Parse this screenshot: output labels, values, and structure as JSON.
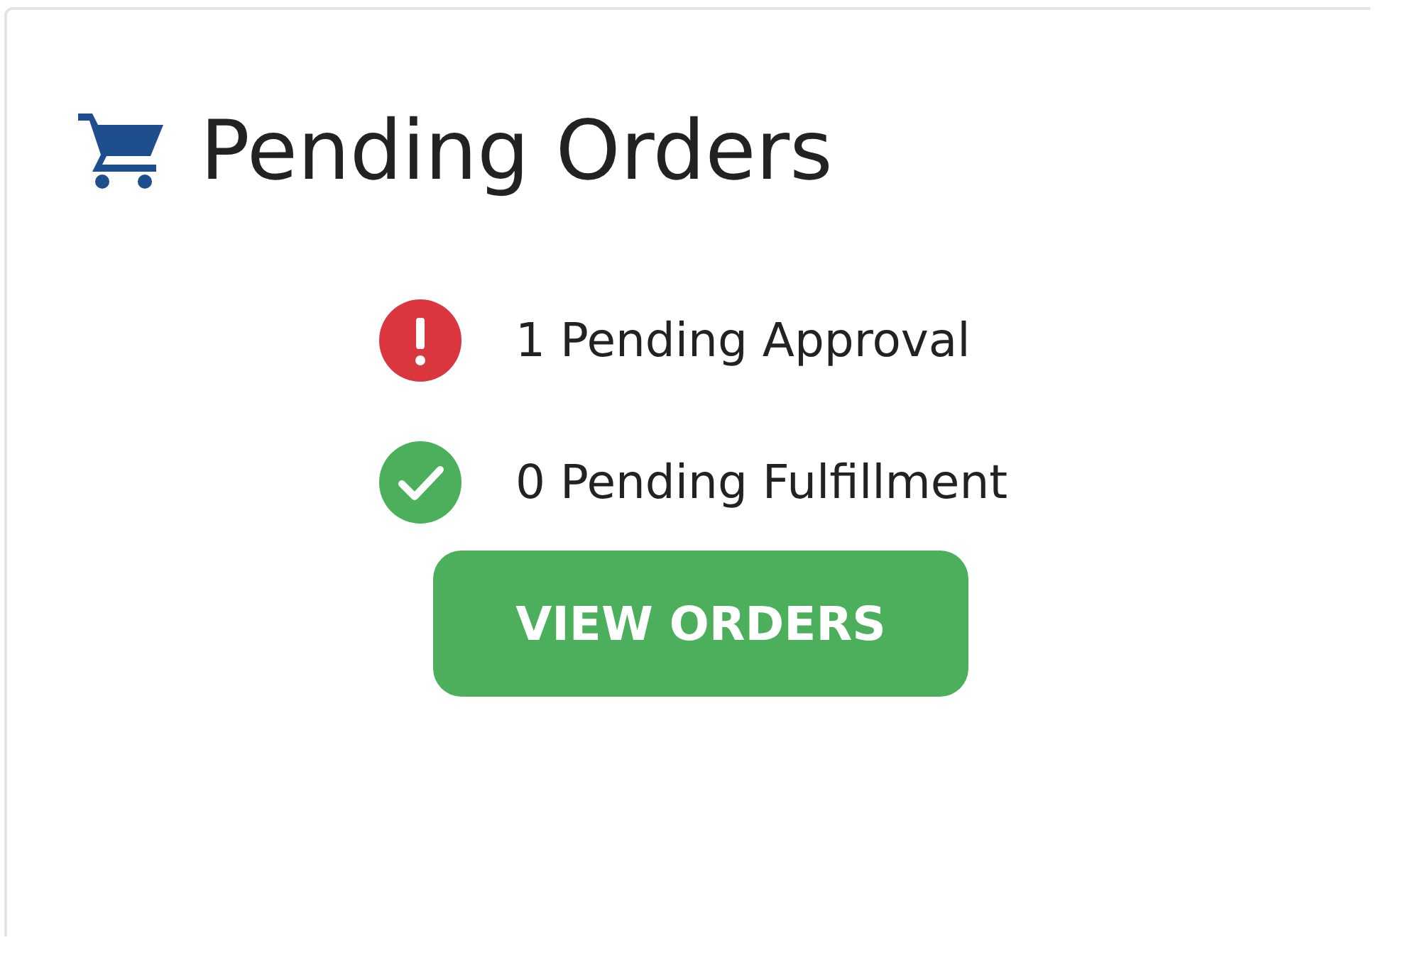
{
  "card": {
    "title": "Pending Orders",
    "statuses": [
      {
        "kind": "alert",
        "label": "1 Pending Approval"
      },
      {
        "kind": "ok",
        "label": "0 Pending Fulfillment"
      }
    ],
    "button": {
      "label": "VIEW ORDERS"
    }
  }
}
